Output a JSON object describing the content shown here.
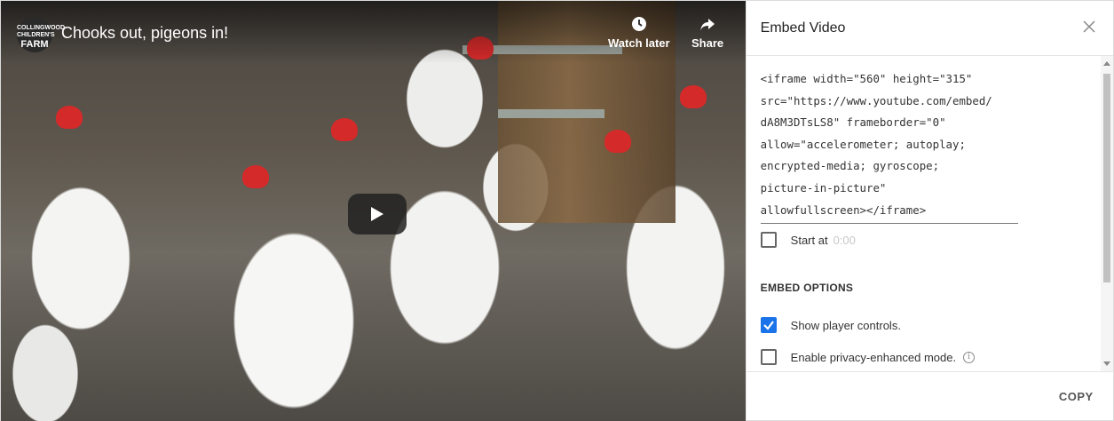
{
  "video": {
    "channel_logo_lines": [
      "COLLINGWOOD",
      "CHILDREN'S",
      "FARM"
    ],
    "title": "Chooks out, pigeons in!",
    "watch_later_label": "Watch later",
    "share_label": "Share",
    "icons": {
      "watch_later": "clock-icon",
      "share": "share-arrow-icon",
      "play": "play-icon"
    }
  },
  "panel": {
    "title": "Embed Video",
    "embed_code": "<iframe width=\"560\" height=\"315\"\nsrc=\"https://www.youtube.com/embed/\ndA8M3DTsLS8\" frameborder=\"0\"\nallow=\"accelerometer; autoplay;\nencrypted-media; gyroscope;\npicture-in-picture\"\nallowfullscreen></iframe>",
    "start_at": {
      "label": "Start at",
      "value": "0:00",
      "checked": false
    },
    "embed_options_heading": "EMBED OPTIONS",
    "options": [
      {
        "label": "Show player controls.",
        "checked": true
      },
      {
        "label": "Enable privacy-enhanced mode.",
        "checked": false
      }
    ],
    "copy_label": "COPY"
  },
  "colors": {
    "checkbox_checked": "#1a73e8",
    "start_value": "#c8c8c8"
  }
}
